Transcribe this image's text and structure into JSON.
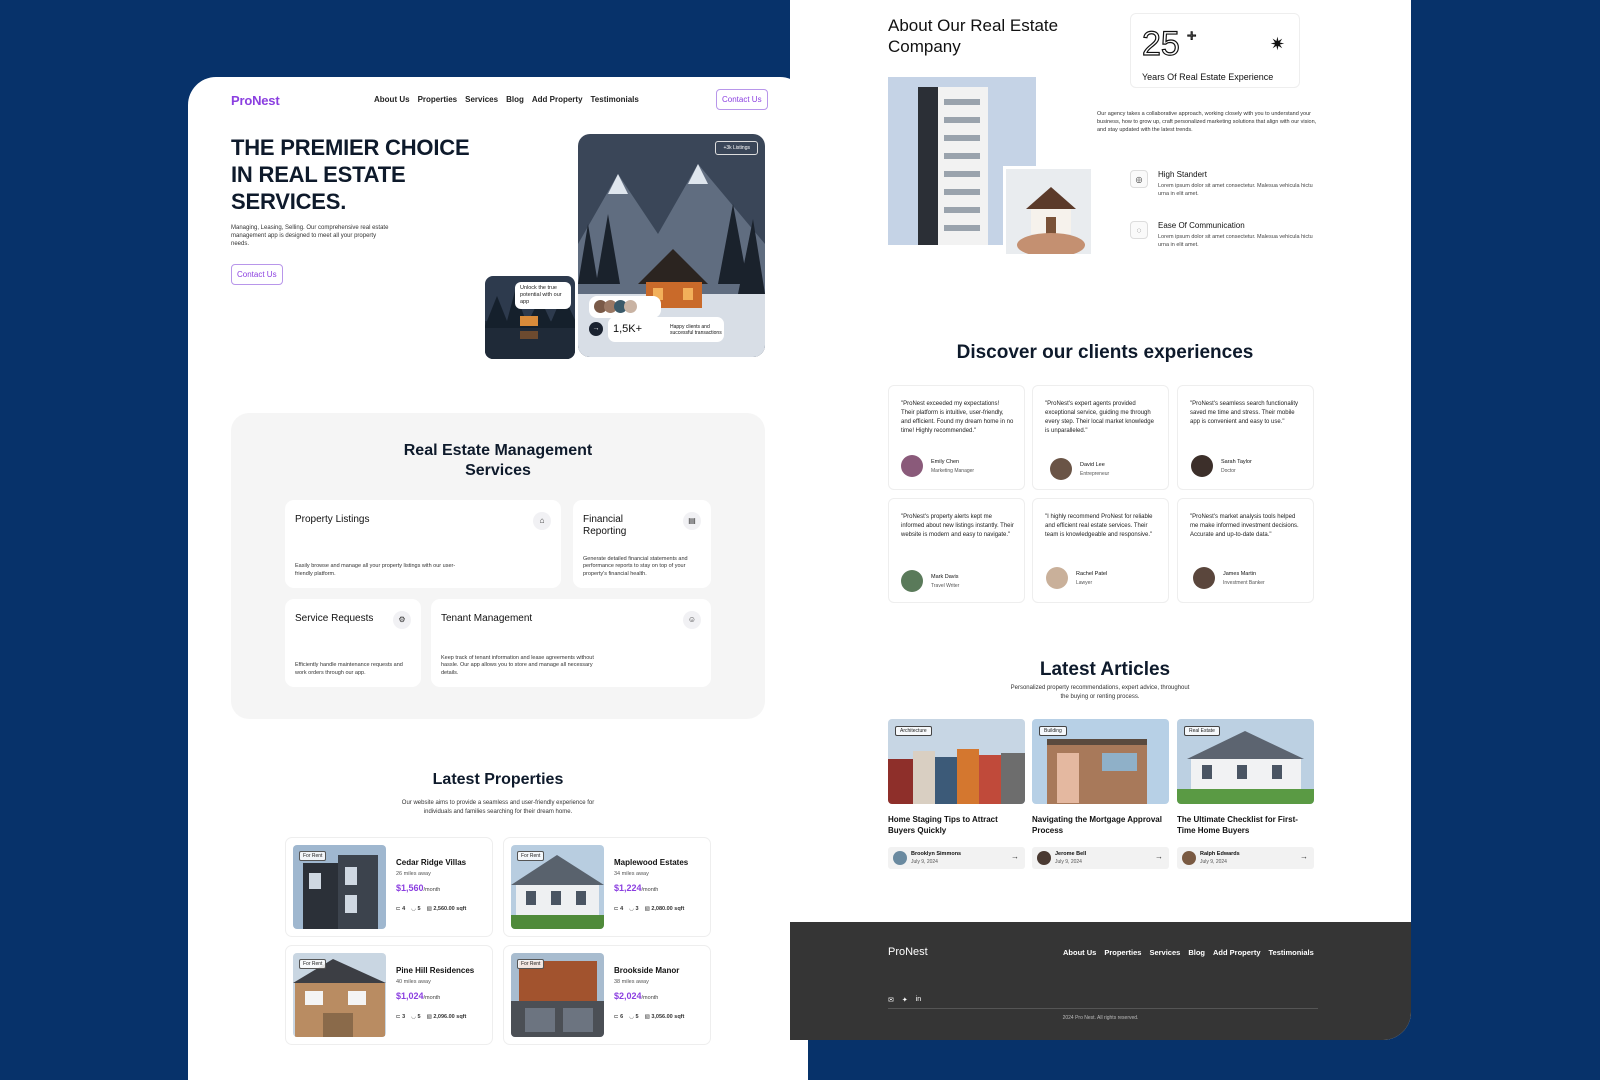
{
  "nav": {
    "logo": "ProNest",
    "links": [
      "About Us",
      "Properties",
      "Services",
      "Blog",
      "Add Property",
      "Testimonials"
    ],
    "cta": "Contact Us"
  },
  "hero": {
    "title": "THE PREMIER CHOICE IN REAL ESTATE SERVICES.",
    "subtitle": "Managing, Leasing, Selling. Our comprehensive real estate management app is designed to meet all your property needs.",
    "cta": "Contact Us",
    "listings_badge": "+3k Listings",
    "bubble_text": "Unlock the true potential with our app",
    "clients_count": "1,5K+",
    "clients_label": "Happy clients and successful transactions"
  },
  "services": {
    "title": "Real Estate Management Services",
    "items": [
      {
        "title": "Property Listings",
        "desc": "Easily browse and manage all your property listings with our user-friendly platform.",
        "icon": "⌂"
      },
      {
        "title": "Financial Reporting",
        "desc": "Generate detailed financial statements and performance reports to stay on top of your property's financial health.",
        "icon": "▤"
      },
      {
        "title": "Service Requests",
        "desc": "Efficiently handle maintenance requests and work orders through our app.",
        "icon": "⚙"
      },
      {
        "title": "Tenant Management",
        "desc": "Keep track of tenant information and lease agreements without hassle. Our app allows you to store and manage all necessary details.",
        "icon": "☺"
      }
    ]
  },
  "properties": {
    "title": "Latest Properties",
    "subtitle": "Our website aims to provide a seamless and user-friendly experience for individuals and families searching for their dream home.",
    "price_unit": "/month",
    "items": [
      {
        "tag": "For Rent",
        "name": "Cedar Ridge Villas",
        "distance": "26 miles away",
        "price": "$1,560",
        "beds": "4",
        "baths": "5",
        "area": "2,560.00 sqft"
      },
      {
        "tag": "For Rent",
        "name": "Maplewood Estates",
        "distance": "34 miles away",
        "price": "$1,224",
        "beds": "4",
        "baths": "3",
        "area": "2,080.00 sqft"
      },
      {
        "tag": "For Rent",
        "name": "Pine Hill Residences",
        "distance": "40 miles away",
        "price": "$1,024",
        "beds": "3",
        "baths": "5",
        "area": "2,096.00 sqft"
      },
      {
        "tag": "For Rent",
        "name": "Brookside Manor",
        "distance": "38 miles away",
        "price": "$2,024",
        "beds": "6",
        "baths": "5",
        "area": "3,056.00 sqft"
      }
    ]
  },
  "about": {
    "title": "About Our Real Estate Company",
    "stat_number": "25",
    "stat_plus": "+",
    "stat_label": "Years Of Real Estate Experience",
    "desc": "Our agency takes a collaborative approach, working closely with you to understand your business, how to grow up, craft personalized marketing solutions that align with our vision, and stay updated with the latest trends.",
    "features": [
      {
        "title": "High Standert",
        "desc": "Lorem ipsum dolor sit amet consectetur. Malesua vehicula hictu urna in elit amet.",
        "icon": "◎"
      },
      {
        "title": "Ease Of Communication",
        "desc": "Lorem ipsum dolor sit amet consectetur. Malesua vehicula hictu urna in elit amet.",
        "icon": "◌"
      }
    ]
  },
  "testimonials": {
    "title": "Discover our clients experiences",
    "items": [
      {
        "quote": "\"ProNest exceeded my expectations! Their platform is intuitive, user-friendly, and efficient. Found my dream home in no time! Highly recommended.\"",
        "name": "Emily Chen",
        "role": "Marketing Manager"
      },
      {
        "quote": "\"ProNest's expert agents provided exceptional service, guiding me through every step. Their local market knowledge is unparalleled.\"",
        "name": "David Lee",
        "role": "Entrepreneur"
      },
      {
        "quote": "\"ProNest's seamless search functionality saved me time and stress. Their mobile app is convenient and easy to use.\"",
        "name": "Sarah Taylor",
        "role": "Doctor"
      },
      {
        "quote": "\"ProNest's property alerts kept me informed about new listings instantly. Their website is modern and easy to navigate.\"",
        "name": "Mark Davis",
        "role": "Travel Writer"
      },
      {
        "quote": "\"I highly recommend ProNest for reliable and efficient real estate services. Their team is knowledgeable and responsive.\"",
        "name": "Rachel Patel",
        "role": "Lawyer"
      },
      {
        "quote": "\"ProNest's market analysis tools helped me make informed investment decisions. Accurate and up-to-date data.\"",
        "name": "James Martin",
        "role": "Investment Banker"
      }
    ]
  },
  "articles": {
    "title": "Latest Articles",
    "subtitle": "Personalized property recommendations, expert advice, throughout the buying or renting process.",
    "items": [
      {
        "tag": "Architecture",
        "title": "Home Staging Tips to Attract Buyers Quickly",
        "author": "Brooklyn Simmons",
        "date": "July 9, 2024"
      },
      {
        "tag": "Building",
        "title": "Navigating the Mortgage Approval Process",
        "author": "Jerome Bell",
        "date": "July 9, 2024"
      },
      {
        "tag": "Real Estate",
        "title": "The Ultimate Checklist for First-Time Home Buyers",
        "author": "Ralph Edwards",
        "date": "July 9, 2024"
      }
    ]
  },
  "footer": {
    "logo": "ProNest",
    "links": [
      "About Us",
      "Properties",
      "Services",
      "Blog",
      "Add Property",
      "Testimonials"
    ],
    "icons": [
      "mail-icon",
      "twitter-icon",
      "linkedin-icon"
    ],
    "copyright": "2024 Pro Nest. All rights reserved."
  },
  "colors": {
    "background": "#07326a",
    "accent": "#8b3fe0",
    "footer": "#353535"
  }
}
